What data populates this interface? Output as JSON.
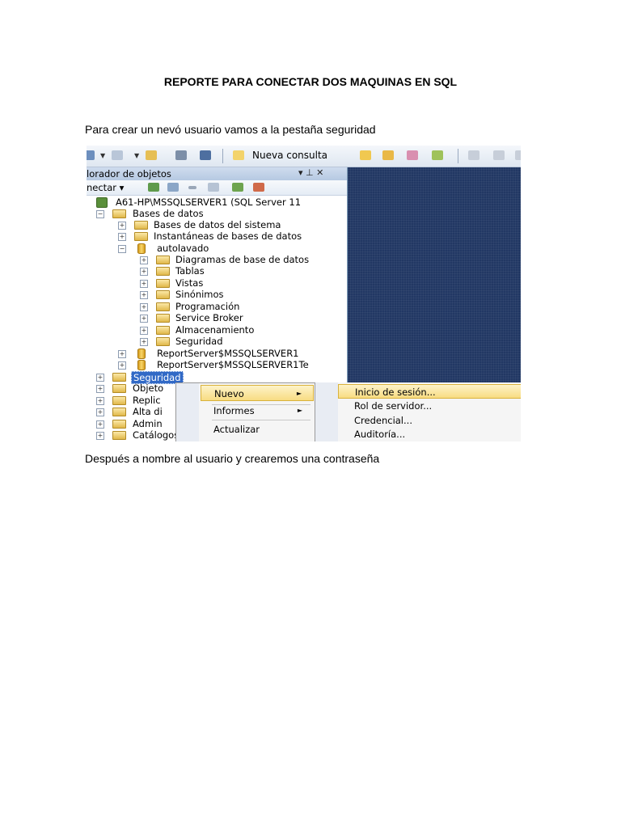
{
  "document": {
    "title": "REPORTE PARA CONECTAR DOS MAQUINAS EN SQL",
    "paragraph1": "Para crear un nevó usuario vamos a la pestaña seguridad",
    "paragraph2": "Después a nombre al usuario y crearemos una contraseña"
  },
  "screenshot": {
    "toolbar": {
      "new_query_label": "Nueva consulta"
    },
    "object_explorer": {
      "title": "lorador de objetos",
      "title_controls": "▾ ⊥ ✕",
      "connect_label": "nectar ▾",
      "tree": {
        "server": "A61-HP\\MSSQLSERVER1 (SQL Server 11",
        "databases": "Bases de datos",
        "system_databases": "Bases de datos del sistema",
        "snapshots": "Instantáneas de bases de datos",
        "autolavado": "autolavado",
        "diagrams": "Diagramas de base de datos",
        "tables": "Tablas",
        "views": "Vistas",
        "synonyms": "Sinónimos",
        "programming": "Programación",
        "service_broker": "Service Broker",
        "storage": "Almacenamiento",
        "db_security": "Seguridad",
        "reportserver": "ReportServer$MSSQLSERVER1",
        "reportserver_temp": "ReportServer$MSSQLSERVER1Te",
        "security": "Seguridad",
        "server_objects": "Objeto",
        "replication": "Replic",
        "always_on": "Alta di",
        "management": "Admin",
        "integration_catalogs": "Catálogos de Integration Servi"
      }
    },
    "context_menu": {
      "new": "Nuevo",
      "reports": "Informes",
      "refresh": "Actualizar",
      "submenu_arrow": "►"
    },
    "submenu": {
      "login": "Inicio de sesión...",
      "server_role": "Rol de servidor...",
      "credential": "Credencial...",
      "audit": "Auditoría..."
    }
  }
}
